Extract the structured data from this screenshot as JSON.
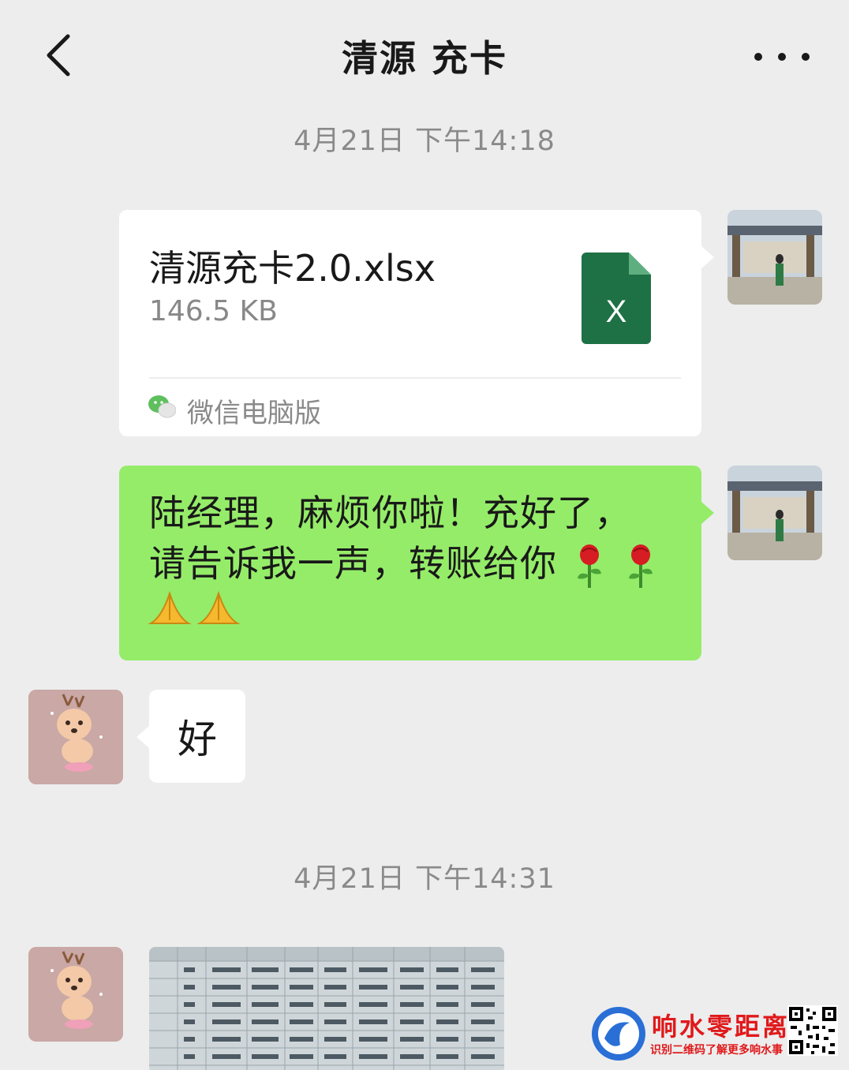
{
  "header": {
    "title": "清源 充卡",
    "back_icon": "chevron-left-icon",
    "more_icon": "more-dots-icon"
  },
  "messages": {
    "timestamp_1": "4月21日 下午14:18",
    "file": {
      "name": "清源充卡2.0.xlsx",
      "size": "146.5 KB",
      "source": "微信电脑版",
      "icon": "excel-file-icon",
      "icon_letter": "X"
    },
    "text_1": {
      "line1": "陆经理，麻烦你啦！充好了，",
      "line2": "请告诉我一声，转账给你",
      "emojis": [
        "rose-icon",
        "rose-icon",
        "pray-icon",
        "pray-icon"
      ]
    },
    "reply": "好",
    "timestamp_2": "4月21日 下午14:31"
  },
  "watermark": {
    "title": "响水零距离",
    "subtitle": "识别二维码了解更多响水事"
  },
  "colors": {
    "background": "#ededed",
    "sent_bubble": "#95ec69",
    "received_bubble": "#ffffff",
    "excel_green": "#1e7145",
    "watermark_red": "#e0191b"
  }
}
